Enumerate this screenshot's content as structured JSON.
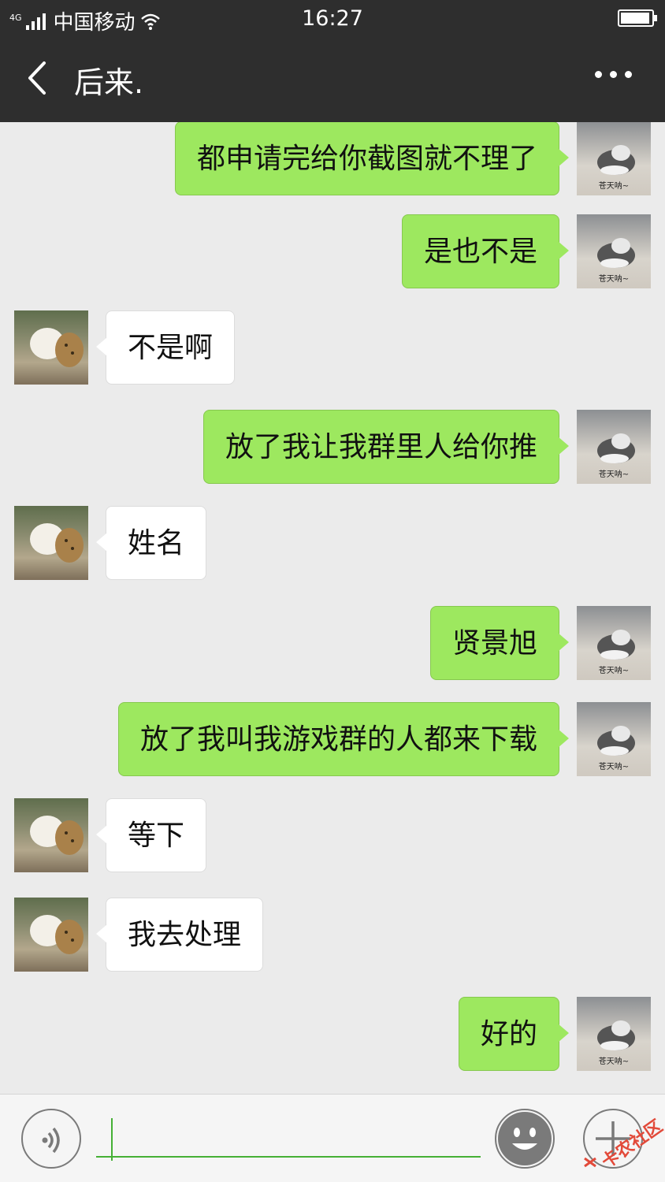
{
  "status_bar": {
    "network_type": "4G",
    "carrier": "中国移动",
    "time": "16:27"
  },
  "header": {
    "title": "后来.",
    "back_icon": "chevron-left-icon",
    "more_icon": "more-dots-icon"
  },
  "messages": [
    {
      "side": "right",
      "text": "都申请完给你截图就不理了"
    },
    {
      "side": "right",
      "text": "是也不是"
    },
    {
      "side": "left",
      "text": "不是啊"
    },
    {
      "side": "right",
      "text": "放了我让我群里人给你推"
    },
    {
      "side": "left",
      "text": "姓名"
    },
    {
      "side": "right",
      "text": "贤景旭"
    },
    {
      "side": "right",
      "text": "放了我叫我游戏群的人都来下载"
    },
    {
      "side": "left",
      "text": "等下"
    },
    {
      "side": "left",
      "text": "我去处理"
    },
    {
      "side": "right",
      "text": "好的"
    }
  ],
  "avatars": {
    "self_caption": "苍天呐~"
  },
  "input_bar": {
    "text_value": "",
    "voice_icon": "voice-icon",
    "emoji_icon": "emoji-icon",
    "plus_icon": "plus-icon"
  },
  "watermark": {
    "text": "卡农社区"
  }
}
